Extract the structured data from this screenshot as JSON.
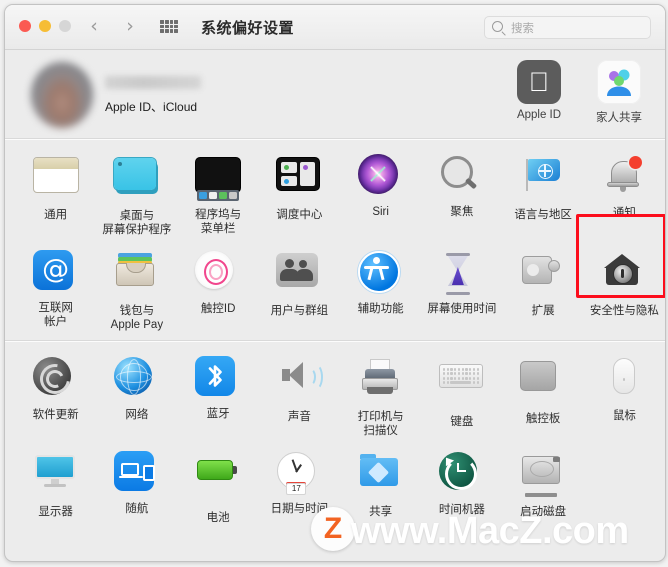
{
  "window": {
    "title": "系统偏好设置",
    "traffic_lights": [
      "close",
      "minimize",
      "zoom"
    ],
    "nav_back": "‹",
    "nav_forward": "›",
    "grid_icon": "grid-view-icon"
  },
  "search": {
    "placeholder": "搜索",
    "value": "",
    "icon": "search-icon"
  },
  "account": {
    "name_redacted": "",
    "subtitle": "Apple ID、iCloud",
    "avatar": "user-avatar-blurred",
    "shortcuts": [
      {
        "label": "Apple ID",
        "icon": "apple-logo-icon"
      },
      {
        "label": "家人共享",
        "icon": "family-sharing-icon"
      }
    ]
  },
  "sections": [
    {
      "name": "personal",
      "rows": [
        [
          {
            "label": "通用",
            "icon": "general-icon"
          },
          {
            "label": "桌面与\n屏幕保护程序",
            "icon": "desktop-screensaver-icon"
          },
          {
            "label": "程序坞与\n菜单栏",
            "icon": "dock-menubar-icon"
          },
          {
            "label": "调度中心",
            "icon": "mission-control-icon"
          },
          {
            "label": "Siri",
            "icon": "siri-icon"
          },
          {
            "label": "聚焦",
            "icon": "spotlight-icon"
          },
          {
            "label": "语言与地区",
            "icon": "language-region-icon"
          },
          {
            "label": "通知",
            "icon": "notifications-icon",
            "badge": true
          }
        ],
        [
          {
            "label": "互联网\n帐户",
            "icon": "internet-accounts-icon"
          },
          {
            "label": "钱包与\nApple Pay",
            "icon": "wallet-applepay-icon"
          },
          {
            "label": "触控ID",
            "icon": "touch-id-icon"
          },
          {
            "label": "用户与群组",
            "icon": "users-groups-icon"
          },
          {
            "label": "辅助功能",
            "icon": "accessibility-icon"
          },
          {
            "label": "屏幕使用时间",
            "icon": "screen-time-icon"
          },
          {
            "label": "扩展",
            "icon": "extensions-icon"
          },
          {
            "label": "安全性与隐私",
            "icon": "security-privacy-icon",
            "highlighted": true
          }
        ]
      ]
    },
    {
      "name": "hardware",
      "rows": [
        [
          {
            "label": "软件更新",
            "icon": "software-update-icon"
          },
          {
            "label": "网络",
            "icon": "network-icon"
          },
          {
            "label": "蓝牙",
            "icon": "bluetooth-icon"
          },
          {
            "label": "声音",
            "icon": "sound-icon"
          },
          {
            "label": "打印机与\n扫描仪",
            "icon": "printers-scanners-icon"
          },
          {
            "label": "键盘",
            "icon": "keyboard-icon"
          },
          {
            "label": "触控板",
            "icon": "trackpad-icon"
          },
          {
            "label": "鼠标",
            "icon": "mouse-icon"
          }
        ],
        [
          {
            "label": "显示器",
            "icon": "displays-icon"
          },
          {
            "label": "随航",
            "icon": "sidecar-icon"
          },
          {
            "label": "电池",
            "icon": "battery-icon"
          },
          {
            "label": "日期与时间",
            "icon": "date-time-icon",
            "day": "17"
          },
          {
            "label": "共享",
            "icon": "sharing-icon"
          },
          {
            "label": "时间机器",
            "icon": "time-machine-icon"
          },
          {
            "label": "启动磁盘",
            "icon": "startup-disk-icon"
          },
          {
            "label": "",
            "icon": ""
          }
        ]
      ]
    }
  ],
  "watermark": {
    "badge_letter": "Z",
    "text": "www.MacZ.com",
    "badge_color": "#f26322",
    "text_color": "#ffffff"
  },
  "colors": {
    "highlight": "#fc0d1c",
    "window_bg": "#ececec",
    "titlebar_bg": "#f1f1f1",
    "badge_red": "#f43f2e"
  },
  "glyphs": {
    "apple": "",
    "at": "@",
    "bluetooth": "",
    "bluetooth_fallback": "ᛒ"
  }
}
